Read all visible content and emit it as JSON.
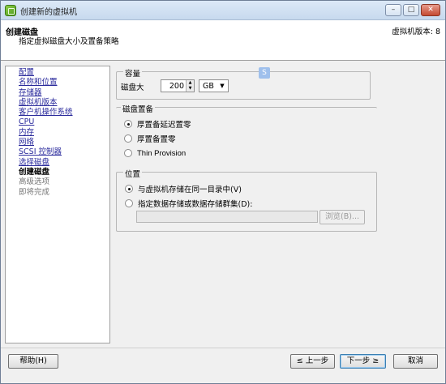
{
  "window": {
    "title": "创建新的虚拟机",
    "controls": {
      "minimize": "–",
      "maximize": "□",
      "close": "✕"
    }
  },
  "header": {
    "title": "创建磁盘",
    "subtitle": "指定虚拟磁盘大小及置备策略",
    "version": "虚拟机版本: 8"
  },
  "nav": {
    "items": [
      {
        "label": "配置",
        "state": "link"
      },
      {
        "label": "名称和位置",
        "state": "link"
      },
      {
        "label": "存储器",
        "state": "link"
      },
      {
        "label": "虚拟机版本",
        "state": "link"
      },
      {
        "label": "客户机操作系统",
        "state": "link"
      },
      {
        "label": "CPU",
        "state": "link"
      },
      {
        "label": "内存",
        "state": "link"
      },
      {
        "label": "网络",
        "state": "link"
      },
      {
        "label": "SCSI 控制器",
        "state": "link"
      },
      {
        "label": "选择磁盘",
        "state": "link"
      },
      {
        "label": "创建磁盘",
        "state": "current"
      },
      {
        "label": "高级选项",
        "state": "disabled"
      },
      {
        "label": "即将完成",
        "state": "disabled"
      }
    ]
  },
  "capacity": {
    "legend": "容量",
    "disk_size_label": "磁盘大",
    "disk_size_value": "200",
    "unit": "GB"
  },
  "provisioning": {
    "legend": "磁盘置备",
    "options": [
      {
        "label": "厚置备延迟置零",
        "checked": true
      },
      {
        "label": "厚置备置零",
        "checked": false
      },
      {
        "label": "Thin Provision",
        "checked": false
      }
    ]
  },
  "location": {
    "legend": "位置",
    "options": [
      {
        "label": "与虚拟机存储在同一目录中(V)",
        "checked": true
      },
      {
        "label": "指定数据存储或数据存储群集(D):",
        "checked": false
      }
    ],
    "path_value": "",
    "browse_label": "浏览(B)..."
  },
  "help_badge": "S",
  "footer": {
    "help": "帮助(H)",
    "back": "≤ 上一步",
    "next": "下一步 ≥",
    "cancel": "取消"
  },
  "colors": {
    "link": "#2a2a9c",
    "titlebar": "#c7d9ee",
    "default_button_border": "#3c7fb1"
  }
}
